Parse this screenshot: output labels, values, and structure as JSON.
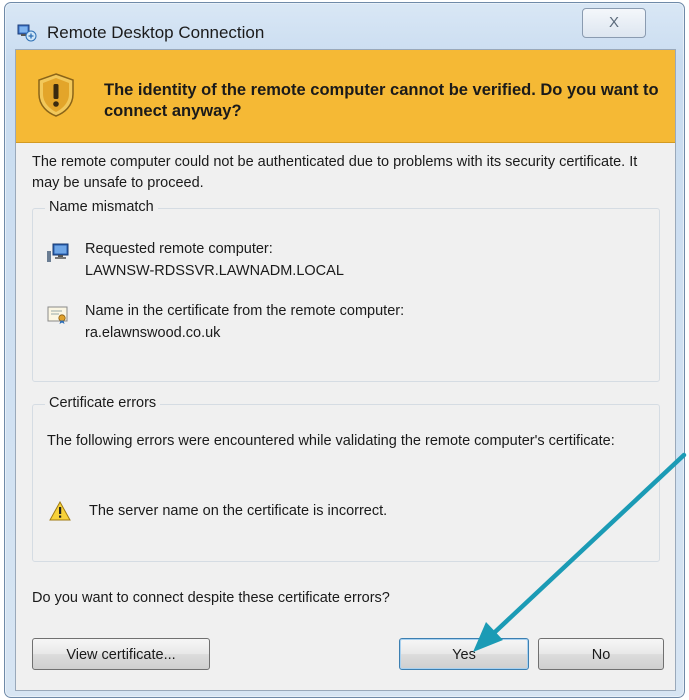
{
  "window": {
    "title": "Remote Desktop Connection",
    "close_glyph": "X"
  },
  "warning": {
    "message": "The identity of the remote computer cannot be verified. Do you want to connect anyway?"
  },
  "intro": "The remote computer could not be authenticated due to problems with its security certificate. It may be unsafe to proceed.",
  "name_mismatch": {
    "legend": "Name mismatch",
    "requested_label": "Requested remote computer:",
    "requested_value": "LAWNSW-RDSSVR.LAWNADM.LOCAL",
    "cert_label": "Name in the certificate from the remote computer:",
    "cert_value": "ra.elawnswood.co.uk"
  },
  "cert_errors": {
    "legend": "Certificate errors",
    "description": "The following errors were encountered while validating the remote computer's certificate:",
    "error": "The server name on the certificate is incorrect."
  },
  "question": "Do you want to connect despite these certificate errors?",
  "buttons": {
    "view_certificate": "View certificate...",
    "yes": "Yes",
    "no": "No"
  },
  "colors": {
    "banner": "#f5b935",
    "annotation_arrow": "#1b9bb5"
  }
}
